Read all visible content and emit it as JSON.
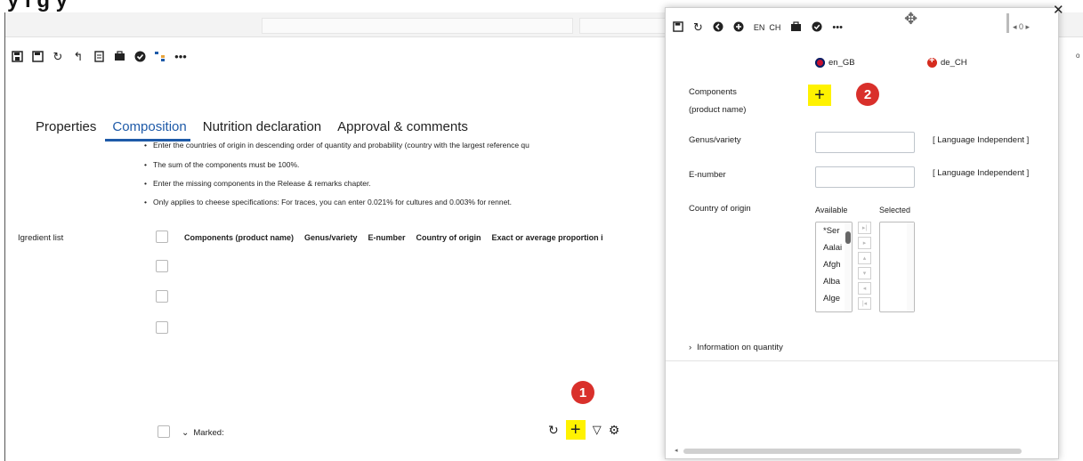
{
  "banner_text": "y i                  g  y                                              ",
  "toolbar": {
    "icons": [
      "save-as-icon",
      "save-icon",
      "refresh-icon",
      "undo-icon",
      "document-icon",
      "briefcase-icon",
      "check-circle-icon",
      "tree-icon",
      "more-icon"
    ]
  },
  "tabs": [
    {
      "label": "Properties",
      "active": false
    },
    {
      "label": "Composition",
      "active": true
    },
    {
      "label": "Nutrition declaration",
      "active": false
    },
    {
      "label": "Approval & comments",
      "active": false
    }
  ],
  "notes": [
    "Enter the countries of origin in descending order of quantity and probability (country with the largest reference qu",
    "The sum of the components must be 100%.",
    "Enter the missing components in the Release & remarks chapter.",
    "Only applies to cheese specifications: For traces, you can enter 0.021% for cultures and 0.003% for rennet."
  ],
  "ingredient": {
    "label": "Igredient list",
    "columns": [
      "Components (product name)",
      "Genus/variety",
      "E-number",
      "Country of origin",
      "Exact or average proportion i"
    ]
  },
  "marked_label": "Marked:",
  "badges": {
    "one": "1",
    "two": "2"
  },
  "right_edge": "o",
  "dialog": {
    "toolbar_lang": [
      "EN",
      "CH"
    ],
    "pager": "0",
    "languages": [
      "en_GB",
      "de_CH"
    ],
    "components_label_1": "Components",
    "components_label_2": "(product name)",
    "genus_label": "Genus/variety",
    "enumber_label": "E-number",
    "country_label": "Country of origin",
    "lang_independent": "[ Language Independent ]",
    "available_head": "Available",
    "selected_head": "Selected",
    "available_items": [
      "*Ser",
      "Aalai",
      "Afgh",
      "Alba",
      "Alge"
    ],
    "info_quantity": "Information on quantity"
  },
  "colors": {
    "accent": "#1e5aa8",
    "highlight": "#fff200",
    "badge": "#d9302b"
  }
}
